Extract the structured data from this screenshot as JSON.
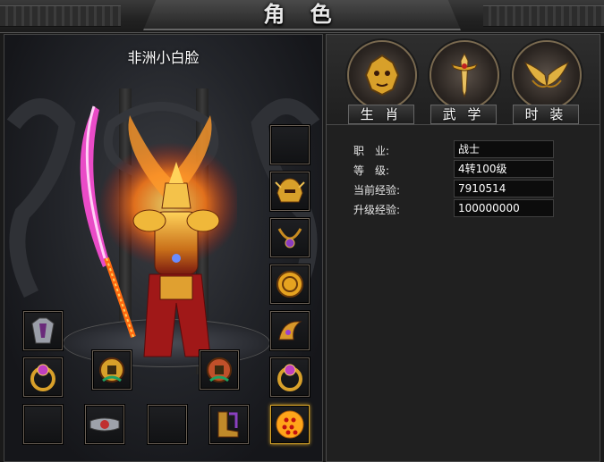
{
  "window": {
    "title": "角 色"
  },
  "character": {
    "name": "非洲小白脸"
  },
  "tabs": [
    {
      "label": "生 肖",
      "icon": "zodiac-lion-icon"
    },
    {
      "label": "武 学",
      "icon": "sword-emblem-icon"
    },
    {
      "label": "时 装",
      "icon": "wings-icon"
    }
  ],
  "stats": [
    {
      "label": "职　业:",
      "value": "战士"
    },
    {
      "label": "等　级:",
      "value": "4转100级"
    },
    {
      "label": "当前经验:",
      "value": "7910514"
    },
    {
      "label": "升级经验:",
      "value": "100000000"
    }
  ],
  "equipment_slots": {
    "right_column": [
      "empty",
      "helmet-icon",
      "necklace-icon",
      "medal-icon",
      "bracelet-icon",
      "ring-icon"
    ],
    "left_column": [
      "armor-icon",
      "ring-icon"
    ],
    "middle": [
      "coin-charm-icon",
      "coin-charm-icon"
    ],
    "bottom": [
      "empty",
      "belt-icon",
      "empty",
      "boots-icon",
      "dragon-ball-icon"
    ]
  },
  "colors": {
    "accent": "#d7a42a",
    "panel_border": "#4a4a4a",
    "fire": "#ff7a18",
    "blade": "#ff4fd8"
  }
}
